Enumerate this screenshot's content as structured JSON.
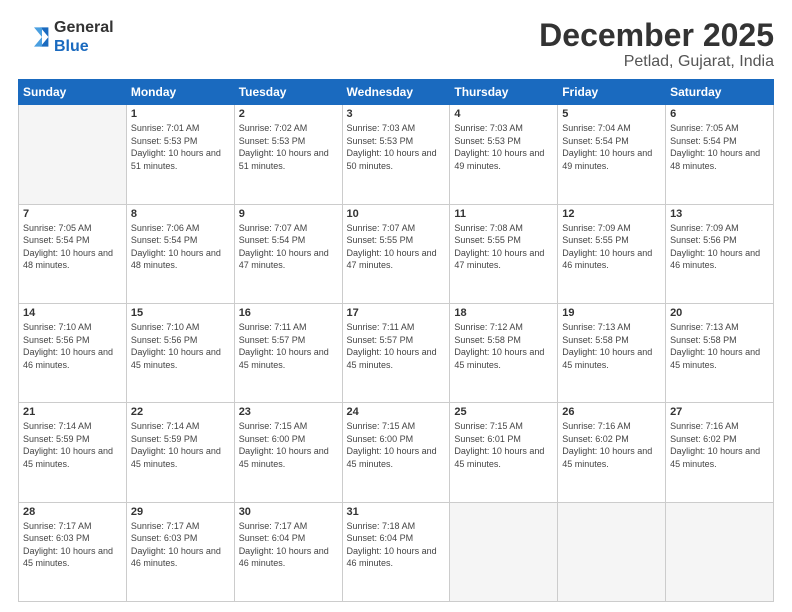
{
  "header": {
    "logo_line1": "General",
    "logo_line2": "Blue",
    "title": "December 2025",
    "subtitle": "Petlad, Gujarat, India"
  },
  "weekdays": [
    "Sunday",
    "Monday",
    "Tuesday",
    "Wednesday",
    "Thursday",
    "Friday",
    "Saturday"
  ],
  "weeks": [
    [
      {
        "day": "",
        "empty": true
      },
      {
        "day": "1",
        "sunrise": "7:01 AM",
        "sunset": "5:53 PM",
        "daylight": "10 hours and 51 minutes."
      },
      {
        "day": "2",
        "sunrise": "7:02 AM",
        "sunset": "5:53 PM",
        "daylight": "10 hours and 51 minutes."
      },
      {
        "day": "3",
        "sunrise": "7:03 AM",
        "sunset": "5:53 PM",
        "daylight": "10 hours and 50 minutes."
      },
      {
        "day": "4",
        "sunrise": "7:03 AM",
        "sunset": "5:53 PM",
        "daylight": "10 hours and 49 minutes."
      },
      {
        "day": "5",
        "sunrise": "7:04 AM",
        "sunset": "5:54 PM",
        "daylight": "10 hours and 49 minutes."
      },
      {
        "day": "6",
        "sunrise": "7:05 AM",
        "sunset": "5:54 PM",
        "daylight": "10 hours and 48 minutes."
      }
    ],
    [
      {
        "day": "7",
        "sunrise": "7:05 AM",
        "sunset": "5:54 PM",
        "daylight": "10 hours and 48 minutes."
      },
      {
        "day": "8",
        "sunrise": "7:06 AM",
        "sunset": "5:54 PM",
        "daylight": "10 hours and 48 minutes."
      },
      {
        "day": "9",
        "sunrise": "7:07 AM",
        "sunset": "5:54 PM",
        "daylight": "10 hours and 47 minutes."
      },
      {
        "day": "10",
        "sunrise": "7:07 AM",
        "sunset": "5:55 PM",
        "daylight": "10 hours and 47 minutes."
      },
      {
        "day": "11",
        "sunrise": "7:08 AM",
        "sunset": "5:55 PM",
        "daylight": "10 hours and 47 minutes."
      },
      {
        "day": "12",
        "sunrise": "7:09 AM",
        "sunset": "5:55 PM",
        "daylight": "10 hours and 46 minutes."
      },
      {
        "day": "13",
        "sunrise": "7:09 AM",
        "sunset": "5:56 PM",
        "daylight": "10 hours and 46 minutes."
      }
    ],
    [
      {
        "day": "14",
        "sunrise": "7:10 AM",
        "sunset": "5:56 PM",
        "daylight": "10 hours and 46 minutes."
      },
      {
        "day": "15",
        "sunrise": "7:10 AM",
        "sunset": "5:56 PM",
        "daylight": "10 hours and 45 minutes."
      },
      {
        "day": "16",
        "sunrise": "7:11 AM",
        "sunset": "5:57 PM",
        "daylight": "10 hours and 45 minutes."
      },
      {
        "day": "17",
        "sunrise": "7:11 AM",
        "sunset": "5:57 PM",
        "daylight": "10 hours and 45 minutes."
      },
      {
        "day": "18",
        "sunrise": "7:12 AM",
        "sunset": "5:58 PM",
        "daylight": "10 hours and 45 minutes."
      },
      {
        "day": "19",
        "sunrise": "7:13 AM",
        "sunset": "5:58 PM",
        "daylight": "10 hours and 45 minutes."
      },
      {
        "day": "20",
        "sunrise": "7:13 AM",
        "sunset": "5:58 PM",
        "daylight": "10 hours and 45 minutes."
      }
    ],
    [
      {
        "day": "21",
        "sunrise": "7:14 AM",
        "sunset": "5:59 PM",
        "daylight": "10 hours and 45 minutes."
      },
      {
        "day": "22",
        "sunrise": "7:14 AM",
        "sunset": "5:59 PM",
        "daylight": "10 hours and 45 minutes."
      },
      {
        "day": "23",
        "sunrise": "7:15 AM",
        "sunset": "6:00 PM",
        "daylight": "10 hours and 45 minutes."
      },
      {
        "day": "24",
        "sunrise": "7:15 AM",
        "sunset": "6:00 PM",
        "daylight": "10 hours and 45 minutes."
      },
      {
        "day": "25",
        "sunrise": "7:15 AM",
        "sunset": "6:01 PM",
        "daylight": "10 hours and 45 minutes."
      },
      {
        "day": "26",
        "sunrise": "7:16 AM",
        "sunset": "6:02 PM",
        "daylight": "10 hours and 45 minutes."
      },
      {
        "day": "27",
        "sunrise": "7:16 AM",
        "sunset": "6:02 PM",
        "daylight": "10 hours and 45 minutes."
      }
    ],
    [
      {
        "day": "28",
        "sunrise": "7:17 AM",
        "sunset": "6:03 PM",
        "daylight": "10 hours and 45 minutes."
      },
      {
        "day": "29",
        "sunrise": "7:17 AM",
        "sunset": "6:03 PM",
        "daylight": "10 hours and 46 minutes."
      },
      {
        "day": "30",
        "sunrise": "7:17 AM",
        "sunset": "6:04 PM",
        "daylight": "10 hours and 46 minutes."
      },
      {
        "day": "31",
        "sunrise": "7:18 AM",
        "sunset": "6:04 PM",
        "daylight": "10 hours and 46 minutes."
      },
      {
        "day": "",
        "empty": true
      },
      {
        "day": "",
        "empty": true
      },
      {
        "day": "",
        "empty": true
      }
    ]
  ]
}
